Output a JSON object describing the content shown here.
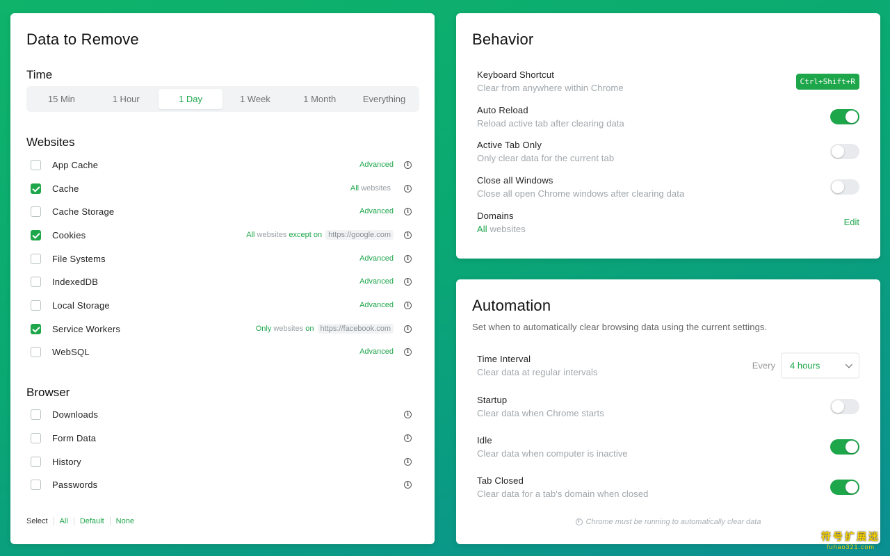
{
  "colors": {
    "accent": "#1ea64b",
    "background_start": "#0fb36a",
    "background_end": "#0b8f93"
  },
  "left": {
    "title": "Data to Remove",
    "time": {
      "heading": "Time",
      "options": [
        "15 Min",
        "1 Hour",
        "1 Day",
        "1 Week",
        "1 Month",
        "Everything"
      ],
      "selected": "1 Day"
    },
    "websites": {
      "heading": "Websites",
      "items": [
        {
          "label": "App Cache",
          "checked": false,
          "right": "Advanced"
        },
        {
          "label": "Cache",
          "checked": true,
          "right_all": "All",
          "right_rest": " websites"
        },
        {
          "label": "Cache Storage",
          "checked": false,
          "right": "Advanced"
        },
        {
          "label": "Cookies",
          "checked": true,
          "right_all": "All",
          "right_mid": " websites ",
          "right_kw": "except on",
          "domain": "https://google.com"
        },
        {
          "label": "File Systems",
          "checked": false,
          "right": "Advanced"
        },
        {
          "label": "IndexedDB",
          "checked": false,
          "right": "Advanced"
        },
        {
          "label": "Local Storage",
          "checked": false,
          "right": "Advanced"
        },
        {
          "label": "Service Workers",
          "checked": true,
          "right_all": "Only",
          "right_mid": " websites ",
          "right_kw": "on",
          "domain": "https://facebook.com"
        },
        {
          "label": "WebSQL",
          "checked": false,
          "right": "Advanced"
        }
      ]
    },
    "browser": {
      "heading": "Browser",
      "items": [
        {
          "label": "Downloads",
          "checked": false
        },
        {
          "label": "Form Data",
          "checked": false
        },
        {
          "label": "History",
          "checked": false
        },
        {
          "label": "Passwords",
          "checked": false
        }
      ]
    },
    "select": {
      "label": "Select",
      "all": "All",
      "default": "Default",
      "none": "None"
    }
  },
  "behavior": {
    "title": "Behavior",
    "keyboard": {
      "title": "Keyboard Shortcut",
      "desc": "Clear from anywhere within Chrome",
      "shortcut": "Ctrl+Shift+R"
    },
    "auto_reload": {
      "title": "Auto Reload",
      "desc": "Reload active tab after clearing data",
      "on": true
    },
    "active_tab": {
      "title": "Active Tab Only",
      "desc": "Only clear data for the current tab",
      "on": false
    },
    "close_windows": {
      "title": "Close all Windows",
      "desc": "Close all open Chrome windows after clearing data",
      "on": false
    },
    "domains": {
      "title": "Domains",
      "desc_all": "All",
      "desc_rest": " websites",
      "edit": "Edit"
    }
  },
  "automation": {
    "title": "Automation",
    "subtitle": "Set when to automatically clear browsing data using the current settings.",
    "interval": {
      "title": "Time Interval",
      "desc": "Clear data at regular intervals",
      "every": "Every",
      "value": "4 hours"
    },
    "startup": {
      "title": "Startup",
      "desc": "Clear data when Chrome starts",
      "on": false
    },
    "idle": {
      "title": "Idle",
      "desc": "Clear data when computer is inactive",
      "on": true
    },
    "tab_closed": {
      "title": "Tab Closed",
      "desc": "Clear data for a tab's domain when closed",
      "on": true
    },
    "note": "Chrome must be running to automatically clear data"
  },
  "watermark": {
    "main": "符号扩展迷",
    "sub": "fuhao321.com"
  }
}
